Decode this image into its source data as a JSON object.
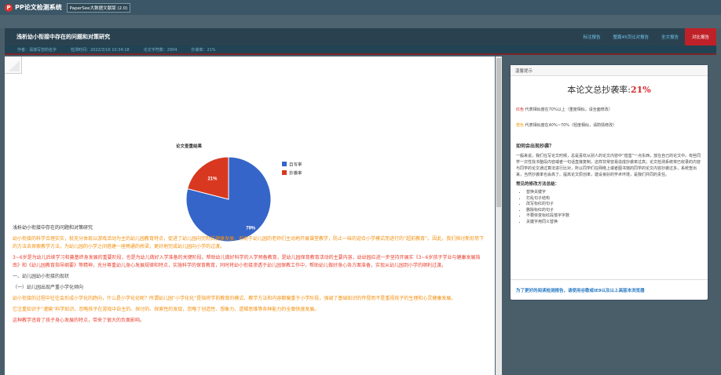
{
  "app": {
    "logo_glyph": "P",
    "title": "PP论文检测系统",
    "version": "PaperSee大数据文献版 (2.0)"
  },
  "header": {
    "doc_title": "浅析幼小衔接中存在的问题和对策研究",
    "tabs": [
      {
        "label": "标注报告"
      },
      {
        "label": "整篇45页比对报告"
      },
      {
        "label": "全文报告"
      },
      {
        "label": "对比报告"
      }
    ]
  },
  "info": {
    "author": "作者：请填写您的名字",
    "time": "检测时间：2022/3/16 10:34:18",
    "chars": "论文字符数：2904",
    "rate": "抄袭率：21%"
  },
  "chart_data": {
    "type": "pie",
    "title": "论文查重结果",
    "categories": [
      "自写率",
      "抄袭率"
    ],
    "values": [
      79,
      21
    ],
    "data_labels": [
      "79%",
      "21%"
    ],
    "colors": [
      "#3565c8",
      "#d8381f"
    ],
    "legend": "top-right"
  },
  "content": {
    "section_title": "浅析幼小衔接中存在的问题和对策研究",
    "paragraphs": [
      {
        "style": "orange",
        "text": "幼小衔接的科学合理实实，就充分体现以游戏活动为主的幼儿园教育特点，促进了幼儿园向完制式健康发展，有助于幼儿园的老师们主动地开展课堂教学，防止一味的迎合小学模式而进行的“超前教育”。因此，我们探讨新形势下的方法去探索教学方法，为幼儿园的小学之间搭建一座畅通的桥梁，更好地完成幼儿园向小学的过渡。"
      },
      {
        "style": "red",
        "text": "3~6岁是为幼儿后续学习和奠基终身发展的重要阶段，也是为幼儿做好入学准备的关键阶段。帮助幼儿做好科学的入学预备教育，是幼儿园保育教育活动的主要内容，幼幼园应进一步坚持开展实《3~6岁孩子学业与健康发展指南》和《幼儿园教育指导纲要》等精神，充分尊重幼儿身心发展规律和特点，实施科学的保育教育，同时将幼小衔接渗透于幼儿园保教工作中，帮助幼儿做好身心各方面准备，实现从幼儿园到小学的顺利过渡。"
      }
    ],
    "heading1": "一、幼儿园幼小衔接的现状",
    "heading2": "（一）幼儿园出现严重小学化倾向",
    "para3": [
      {
        "style": "orange",
        "text": "幼小衔接的过程中往往会形成小学化的趋向，什么是小学化化呢？所谓幼儿园“小学化化”是指将学前教育的模式、教学方法和内容都偏重于小学阶段，强调了基础知识的传授而不是重视孩子的生理和心灵健康发展。"
      },
      {
        "style": "orange",
        "text": "它注重知识于“灌输”科学知识，忽略孩子在游戏中自主的、探讨的、探索性的发现，忽略了创造性、想象力、逻辑思维等各种能力的全面快速发展。"
      },
      {
        "style": "red",
        "text": "这种教学违背了孩子身心发展的特点，带来了很大的负面影响。"
      }
    ]
  },
  "sidebar": {
    "card_title": "温馨提示",
    "rate_label": "本论文总抄袭率:",
    "rate_value": "21%",
    "legend_red_kw": "红色",
    "legend_red_text": "代表相似度在70%以上（重度相似，请全面修改）",
    "legend_orange_kw": "橙色",
    "legend_orange_text": "代表相似度在40%~70%（轻度相似，请酌情修改）",
    "how_title": "如何会出现抄袭？",
    "how_text": "一般来说，我们在写论文时候，总是喜欢从别人的论文内容中“借鉴”一点东西，放在自己的论文中。有些同学一次性找书整段内容或者一句话直接复制，这样非常容易造成抄袭率过高；论文检测系统将已收录的内容与同学的论文通过算法进行比对，所以同学们在网络上或者图书馆的同学的论文内容抄袭过多，系统查出来，当然抄袭率也会高了。提高论文原创率，建设良好的学术环境，是我们共同的责任。",
    "ways_title": "常见的修改方法总结：",
    "ways": [
      "替换关键字",
      "打乱句子结构",
      "改写标红的句子",
      "删除标红的句子",
      "不要依变标红段落字字数",
      "关键字用同义替换"
    ],
    "footer": "为了更好的阅读检测报告，请使用谷歌或IE9以及以上高版本浏览器"
  }
}
